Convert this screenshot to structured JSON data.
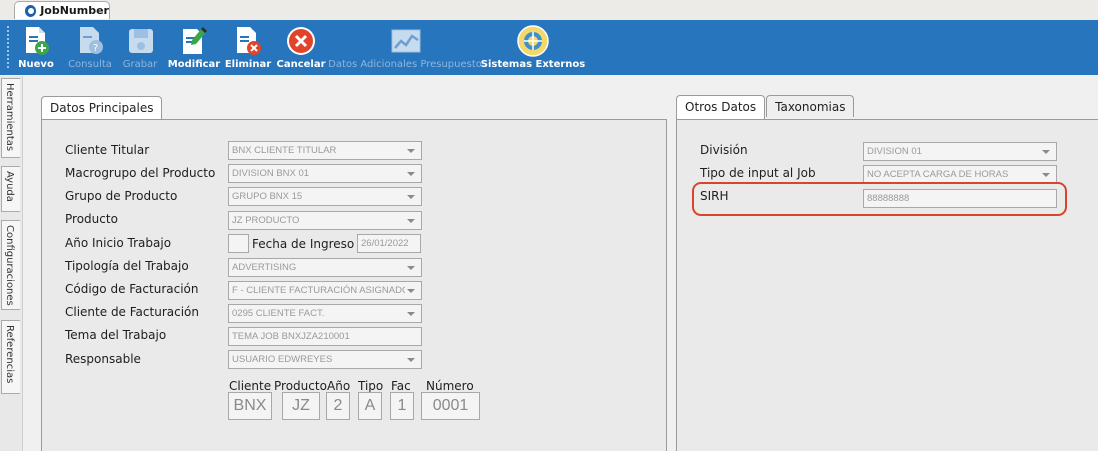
{
  "window": {
    "tab_title": "JobNumber"
  },
  "toolbar": {
    "buttons": [
      {
        "label": "Nuevo",
        "enabled": true,
        "icon": "new-document-icon"
      },
      {
        "label": "Consulta",
        "enabled": false,
        "icon": "query-document-icon"
      },
      {
        "label": "Grabar",
        "enabled": false,
        "icon": "save-disk-icon"
      },
      {
        "label": "Modificar",
        "enabled": true,
        "icon": "edit-document-icon"
      },
      {
        "label": "Eliminar",
        "enabled": true,
        "icon": "delete-document-icon"
      },
      {
        "label": "Cancelar",
        "enabled": true,
        "icon": "cancel-icon"
      },
      {
        "label": "Datos Adicionales Presupuesto",
        "enabled": false,
        "icon": "chart-icon"
      },
      {
        "label": "Sistemas Externos",
        "enabled": true,
        "icon": "external-systems-icon"
      }
    ]
  },
  "side_tabs": [
    "Herramientas",
    "Ayuda",
    "Configuraciones",
    "Referencias"
  ],
  "left_panel": {
    "tab": "Datos Principales",
    "fields": {
      "cliente_titular": {
        "label": "Cliente Titular",
        "value": "BNX CLIENTE TITULAR"
      },
      "macrogrupo": {
        "label": "Macrogrupo del Producto",
        "value": "DIVISION BNX 01"
      },
      "grupo": {
        "label": "Grupo de Producto",
        "value": "GRUPO BNX 15"
      },
      "producto": {
        "label": "Producto",
        "value": "JZ PRODUCTO"
      },
      "anio": {
        "label": "Año Inicio Trabajo",
        "value": "2"
      },
      "fecha": {
        "label": "Fecha de Ingreso",
        "value": "26/01/2022"
      },
      "tipologia": {
        "label": "Tipología del Trabajo",
        "value": "ADVERTISING"
      },
      "codigo_fact": {
        "label": "Código de Facturación",
        "value": "F - CLIENTE FACTURACIÓN ASIGNADO"
      },
      "cliente_fact": {
        "label": "Cliente de Facturación",
        "value": "0295 CLIENTE FACT."
      },
      "tema": {
        "label": "Tema del Trabajo",
        "value": "TEMA JOB BNXJZA210001"
      },
      "responsable": {
        "label": "Responsable",
        "value": "USUARIO EDWREYES"
      }
    },
    "code": {
      "labels": [
        "Cliente",
        "Producto",
        "Año",
        "Tipo",
        "Fac",
        "Número"
      ],
      "values": [
        "BNX",
        "JZ",
        "2",
        "A",
        "1",
        "0001"
      ]
    }
  },
  "right_panel": {
    "tabs": [
      "Otros Datos",
      "Taxonomias"
    ],
    "fields": {
      "division": {
        "label": "División",
        "value": "DIVISION 01"
      },
      "tipo_input": {
        "label": "Tipo de input al Job",
        "value": "NO ACEPTA CARGA DE HORAS"
      },
      "sirh": {
        "label": "SIRH",
        "value": "88888888"
      }
    }
  },
  "colors": {
    "toolbar": "#2776bd",
    "highlight": "#d9452b"
  }
}
